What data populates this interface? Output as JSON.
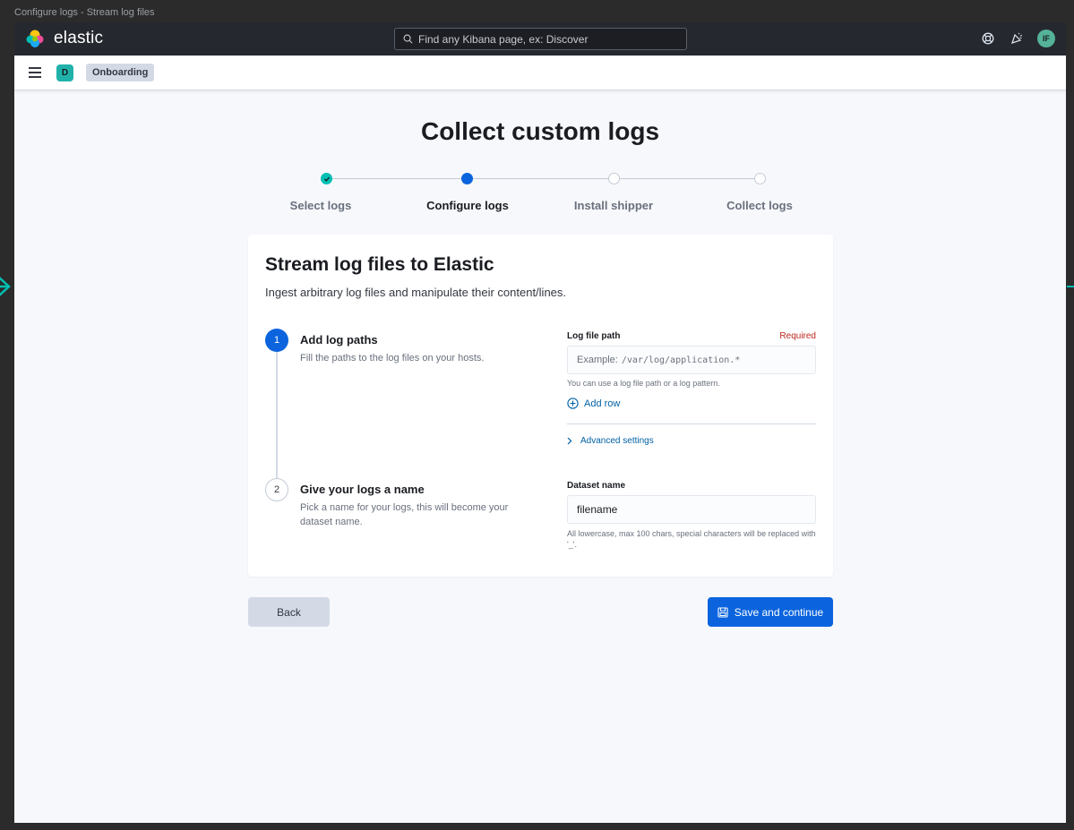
{
  "window": {
    "title": "Configure logs - Stream log files"
  },
  "header": {
    "brand": "elastic",
    "search_placeholder": "Find any Kibana page, ex: Discover",
    "user_initials": "IF"
  },
  "subbar": {
    "space_initial": "D",
    "breadcrumb": "Onboarding"
  },
  "page": {
    "title": "Collect custom logs"
  },
  "stepper": {
    "steps": [
      {
        "label": "Select logs",
        "status": "complete"
      },
      {
        "label": "Configure logs",
        "status": "current"
      },
      {
        "label": "Install shipper",
        "status": "incomplete"
      },
      {
        "label": "Collect logs",
        "status": "incomplete"
      }
    ]
  },
  "card": {
    "title": "Stream log files to Elastic",
    "subtitle": "Ingest arbitrary log files and manipulate their content/lines.",
    "steps": [
      {
        "number": "1",
        "title": "Add log paths",
        "description": "Fill the paths to the log files on your hosts."
      },
      {
        "number": "2",
        "title": "Give your logs a name",
        "description": "Pick a name for your logs, this will become your dataset name."
      }
    ],
    "log_path": {
      "label": "Log file path",
      "required": "Required",
      "placeholder_prefix": "Example:",
      "placeholder_code": "/var/log/application.*",
      "help": "You can use a log file path or a log pattern.",
      "add_row": "Add row",
      "advanced": "Advanced settings"
    },
    "dataset": {
      "label": "Dataset name",
      "value": "filename",
      "help": "All lowercase, max 100 chars, special characters will be replaced with '_'."
    }
  },
  "actions": {
    "back": "Back",
    "save": "Save and continue"
  },
  "colors": {
    "accent": "#0b64dd",
    "success": "#00bfb3",
    "danger": "#bd271e",
    "header_bg": "#25282f"
  }
}
